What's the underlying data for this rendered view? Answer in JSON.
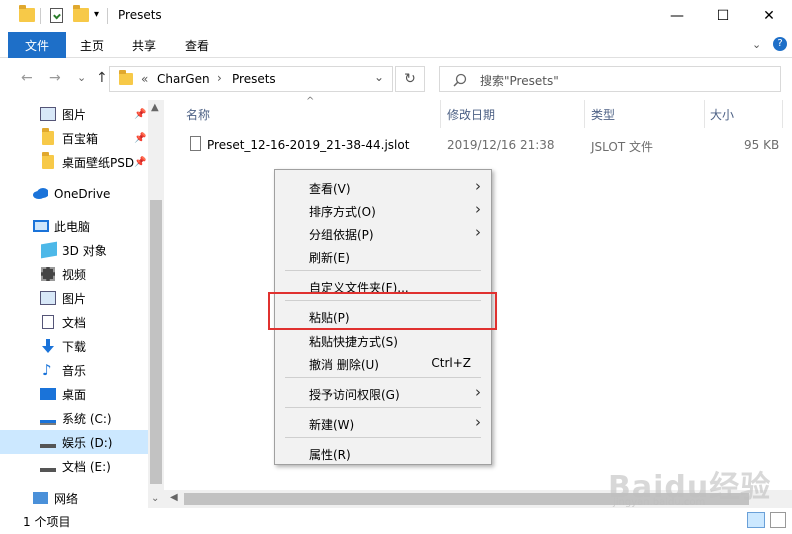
{
  "window": {
    "title": "Presets",
    "minimize": "—",
    "maximize": "☐",
    "close": "✕"
  },
  "ribbon": {
    "tabs": [
      "文件",
      "主页",
      "共享",
      "查看"
    ],
    "help": "?"
  },
  "address": {
    "prefix": "«",
    "path": [
      "CharGen",
      "Presets"
    ],
    "separator": "›",
    "dropdown": "⌄",
    "refresh": "↻",
    "search_placeholder": "搜索\"Presets\""
  },
  "nav": {
    "back": "←",
    "forward": "→",
    "recent": "⌄",
    "up": "↑"
  },
  "sidebar": {
    "quick_access": [
      {
        "label": "图片",
        "icon": "pictures-icon",
        "pinned": true
      },
      {
        "label": "百宝箱",
        "icon": "folder-icon",
        "pinned": true
      },
      {
        "label": "桌面壁纸PSD",
        "icon": "folder-icon",
        "pinned": true
      }
    ],
    "onedrive": "OneDrive",
    "this_pc": "此电脑",
    "pc_items": [
      {
        "label": "3D 对象",
        "icon": "3d-objects-icon"
      },
      {
        "label": "视频",
        "icon": "videos-icon"
      },
      {
        "label": "图片",
        "icon": "pictures-icon"
      },
      {
        "label": "文档",
        "icon": "documents-icon"
      },
      {
        "label": "下载",
        "icon": "downloads-icon"
      },
      {
        "label": "音乐",
        "icon": "music-icon"
      },
      {
        "label": "桌面",
        "icon": "desktop-icon"
      },
      {
        "label": "系统 (C:)",
        "icon": "drive-c-icon"
      },
      {
        "label": "娱乐 (D:)",
        "icon": "drive-icon",
        "selected": true
      },
      {
        "label": "文档 (E:)",
        "icon": "drive-icon"
      }
    ],
    "network": "网络"
  },
  "columns": {
    "name": "名称",
    "modified": "修改日期",
    "type": "类型",
    "size": "大小"
  },
  "files": [
    {
      "name": "Preset_12-16-2019_21-38-44.jslot",
      "modified": "2019/12/16 21:38",
      "type": "JSLOT 文件",
      "size": "95 KB"
    }
  ],
  "context_menu": {
    "items": [
      {
        "label": "查看(V)",
        "submenu": true
      },
      {
        "label": "排序方式(O)",
        "submenu": true
      },
      {
        "label": "分组依据(P)",
        "submenu": true
      },
      {
        "label": "刷新(E)"
      },
      {
        "label": "自定义文件夹(F)..."
      },
      {
        "label": "粘贴(P)",
        "highlighted": true
      },
      {
        "label": "粘贴快捷方式(S)"
      },
      {
        "label": "撤消 删除(U)",
        "shortcut": "Ctrl+Z"
      },
      {
        "label": "授予访问权限(G)",
        "submenu": true
      },
      {
        "label": "新建(W)",
        "submenu": true
      },
      {
        "label": "属性(R)"
      }
    ]
  },
  "status": {
    "item_count": "1 个项目"
  },
  "watermark": {
    "text": "Baidu经验",
    "url": "jingyan.baidu.com"
  },
  "colors": {
    "accent": "#1e6fc8",
    "selection": "#cce8ff",
    "highlight_border": "#e0312f"
  }
}
